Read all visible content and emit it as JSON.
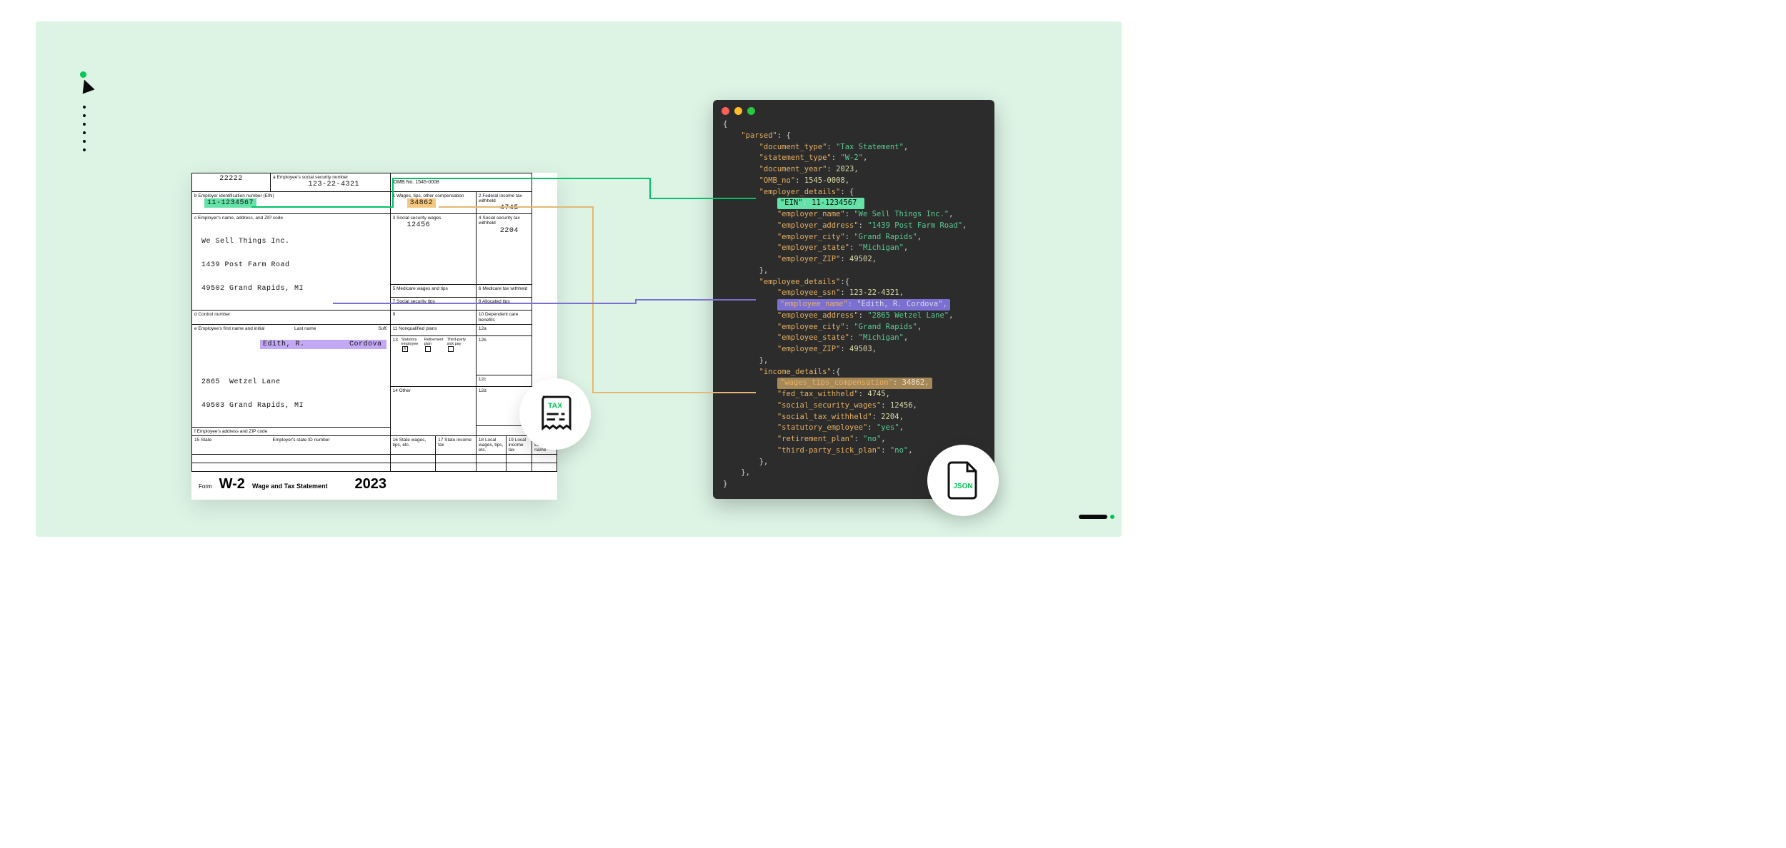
{
  "form": {
    "name": "W-2",
    "title": "Wage and Tax Statement",
    "year": "2023",
    "omb": "OMB No. 1545-0008",
    "void_code": "22222"
  },
  "boxes": {
    "a": "a  Employee's social security number",
    "b": "b  Employer identification number (EIN)",
    "c": "c  Employer's name, address, and ZIP code",
    "d": "d  Control number",
    "e": "e  Employee's first name and initial",
    "e_last": "Last name",
    "e_suff": "Suff.",
    "f": "f  Employee's address and ZIP code",
    "b1": "1   Wages, tips, other compensation",
    "b2": "2   Federal income tax withheld",
    "b3": "3   Social security wages",
    "b4": "4   Social security tax withheld",
    "b5": "5   Medicare wages and tips",
    "b6": "6   Medicare tax withheld",
    "b7": "7   Social security tips",
    "b8": "8   Allocated tips",
    "b9": "9",
    "b10": "10  Dependent care benefits",
    "b11": "11  Nonqualified plans",
    "b12a": "12a",
    "b12b": "12b",
    "b12c": "12c",
    "b12d": "12d",
    "b13_stat": "Statutory employee",
    "b13_ret": "Retirement plan",
    "b13_3p": "Third-party sick pay",
    "b13": "13",
    "b14": "14  Other",
    "b15": "15  State",
    "b15b": "Employer's state ID number",
    "b16": "16  State wages, tips, etc.",
    "b17": "17  State income tax",
    "b18": "18  Local wages, tips, etc.",
    "b19": "19  Local income tax",
    "b20": "20  Locality name"
  },
  "values": {
    "ssn": "123-22-4321",
    "ein": "11-1234567",
    "employer_name": "We Sell Things Inc.",
    "employer_addr1": "1439 Post Farm Road",
    "employer_addr2": "49502 Grand Rapids, MI",
    "wages": "34862",
    "fed_tax": "4745",
    "ss_wages": "12456",
    "ss_tax": "2204",
    "emp_first": "Edith, R.",
    "emp_last": "Cordova",
    "emp_addr1": "2865  Wetzel Lane",
    "emp_addr2": "49503 Grand Rapids, MI",
    "check_stat": "X"
  },
  "json": {
    "parsed": "\"parsed\"",
    "doc_type_k": "\"document_type\"",
    "doc_type_v": "\"Tax Statement\"",
    "stmt_type_k": "\"statement_type\"",
    "stmt_type_v": "\"W-2\"",
    "doc_year_k": "\"document_year\"",
    "doc_year_v": "2023",
    "omb_k": "\"OMB_no\"",
    "omb_v": "1545-0008",
    "emp_details_k": "\"employer_details\"",
    "ein_k": "\"EIN\"",
    "ein_v": "11-1234567",
    "ename_k": "\"employer_name\"",
    "ename_v": "\"We Sell Things Inc.\"",
    "eaddr_k": "\"employer_address\"",
    "eaddr_v": "\"1439 Post Farm Road\"",
    "ecity_k": "\"employer_city\"",
    "ecity_v": "\"Grand Rapids\"",
    "estate_k": "\"employer_state\"",
    "estate_v": "\"Michigan\"",
    "ezip_k": "\"employer_ZIP\"",
    "ezip_v": "49502",
    "ee_details_k": "\"employee_details\"",
    "essn_k": "\"employee_ssn\"",
    "essn_v": "123-22-4321",
    "eename_k": "\"employee_name\"",
    "eename_v": "\"Edith, R. Cordova\"",
    "eeaddr_k": "\"employee_address\"",
    "eeaddr_v": "\"2865 Wetzel Lane\"",
    "eecity_k": "\"employee_city\"",
    "eecity_v": "\"Grand Rapids\"",
    "eestate_k": "\"employee_state\"",
    "eestate_v": "\"Michigan\"",
    "eezip_k": "\"employee_ZIP\"",
    "eezip_v": "49503",
    "inc_k": "\"income_details\"",
    "wtc_k": "\"wages_tips_compensation\"",
    "wtc_v": "34862",
    "ftw_k": "\"fed_tax_withheld\"",
    "ftw_v": "4745",
    "ssw_k": "\"social_security_wages\"",
    "ssw_v": "12456",
    "stw_k": "\"social_tax_withheld\"",
    "stw_v": "2204",
    "se_k": "\"statutory_employee\"",
    "se_v": "\"yes\"",
    "rp_k": "\"retirement_plan\"",
    "rp_v": "\"no\"",
    "tp_k": "\"third-party_sick_plan\"",
    "tp_v": "\"no\""
  },
  "badges": {
    "tax": "TAX",
    "json": "JSON"
  },
  "colors": {
    "green": "#63E3A8",
    "purple": "#7B6FD1",
    "orange": "#E6B772"
  }
}
